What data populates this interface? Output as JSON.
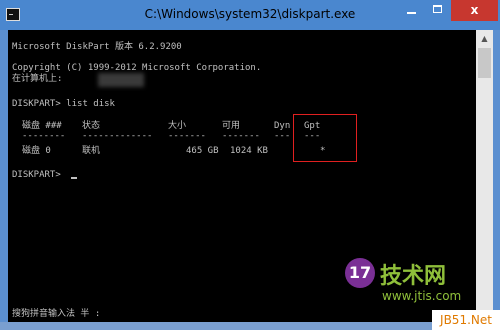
{
  "window": {
    "title": "C:\\Windows\\system32\\diskpart.exe",
    "min_icon": "minimize-icon",
    "max_icon": "maximize-icon",
    "close_icon": "close-icon",
    "close_glyph": "x"
  },
  "console": {
    "lines": [
      "Microsoft DiskPart 版本 6.2.9200",
      "Copyright (C) 1999-2012 Microsoft Corporation.",
      "在计算机上: ",
      "DISKPART> list disk",
      "DISKPART> "
    ],
    "table": {
      "headers": [
        "磁盘 ###",
        "状态",
        "大小",
        "可用",
        "Dyn",
        "Gpt"
      ],
      "dashes": [
        "--------",
        "-------------",
        "-------",
        "-------",
        "---",
        "---"
      ],
      "rows": [
        [
          "磁盘 0",
          "联机",
          "465 GB",
          "1024 KB",
          "",
          "*"
        ]
      ]
    },
    "ime_status": "搜狗拼音输入法 半 :"
  },
  "watermark": {
    "logo": "17",
    "title": "技术网",
    "url": "www.jtis.com",
    "footer": "JB51.Net"
  },
  "colors": {
    "titlebar": "#4a87cf",
    "close_button": "#c7372f",
    "console_bg": "#000000",
    "console_text": "#c0c0c0",
    "highlight_border": "#e02020"
  }
}
